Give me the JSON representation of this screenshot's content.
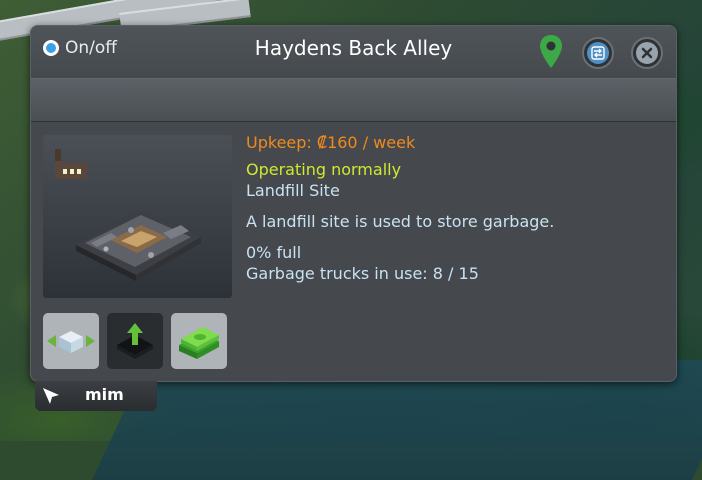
{
  "header": {
    "onoff_label": "On/off",
    "title": "Haydens Back Alley"
  },
  "info": {
    "upkeep": "Upkeep: ₡160 / week",
    "status": "Operating normally",
    "type": "Landfill Site",
    "description": "A landfill site is used to store garbage.",
    "fill": "0% full",
    "trucks": "Garbage trucks in use: 8 / 15"
  },
  "icons": {
    "location": "location-pin-icon",
    "swap": "swap-icon",
    "close": "close-icon",
    "category": "industry-factory-icon",
    "move": "move-building-icon",
    "upgrade": "upgrade-icon",
    "budget": "budget-money-icon",
    "cursor": "cursor-arrow-icon"
  },
  "tag": {
    "name": "mim"
  },
  "colors": {
    "upkeep": "#f08a1e",
    "status": "#cfe832",
    "text": "#c9e1f2",
    "accent": "#3aa1e8",
    "pin": "#3ca846"
  }
}
